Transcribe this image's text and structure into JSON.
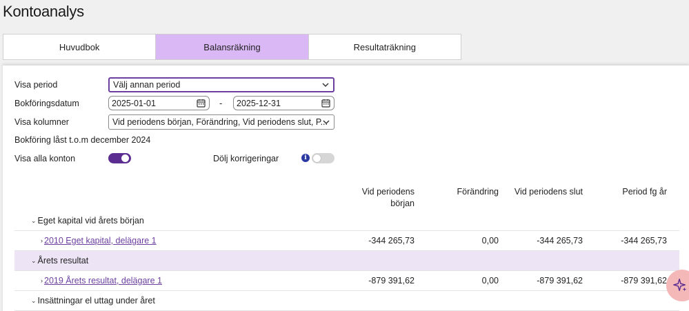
{
  "page": {
    "title": "Kontoanalys"
  },
  "tabs": [
    {
      "label": "Huvudbok",
      "active": false
    },
    {
      "label": "Balansräkning",
      "active": true
    },
    {
      "label": "Resultaträkning",
      "active": false
    }
  ],
  "filters": {
    "period_label": "Visa period",
    "period_value": "Välj annan period",
    "date_label": "Bokföringsdatum",
    "date_from": "2025-01-01",
    "date_to": "2025-12-31",
    "date_separator": "-",
    "columns_label": "Visa kolumner",
    "columns_value": "Vid periodens början, Förändring, Vid periodens slut, P...",
    "locked_text": "Bokföring låst t.o.m december 2024",
    "show_all_label": "Visa alla konton",
    "show_all_on": true,
    "hide_corrections_label": "Dölj korrigeringar",
    "hide_corrections_on": false,
    "info_glyph": "i"
  },
  "table": {
    "columns": [
      "Vid periodens början",
      "Förändring",
      "Vid periodens slut",
      "Period fg år"
    ],
    "rows": [
      {
        "type": "group",
        "label": "Eget kapital vid årets början"
      },
      {
        "type": "account",
        "label": "2010 Eget kapital, delägare 1",
        "values": [
          "-344 265,73",
          "0,00",
          "-344 265,73",
          "-344 265,73"
        ]
      },
      {
        "type": "group",
        "label": "Årets resultat"
      },
      {
        "type": "account",
        "label": "2019 Årets resultat, delägare 1",
        "values": [
          "-879 391,62",
          "0,00",
          "-879 391,62",
          "-879 391,62"
        ]
      },
      {
        "type": "group",
        "label": "Insättningar el uttag under året"
      }
    ]
  },
  "colors": {
    "accent": "#5b2d91",
    "tab_active": "#d9b8f5",
    "row_highlight": "#ede4f6",
    "link": "#6b3fa0",
    "fab": "#f4b8b8"
  },
  "icons": {
    "caret_group": "chevron-down-icon",
    "caret_account": "chevron-right-icon",
    "fab": "sparkle-icon"
  }
}
